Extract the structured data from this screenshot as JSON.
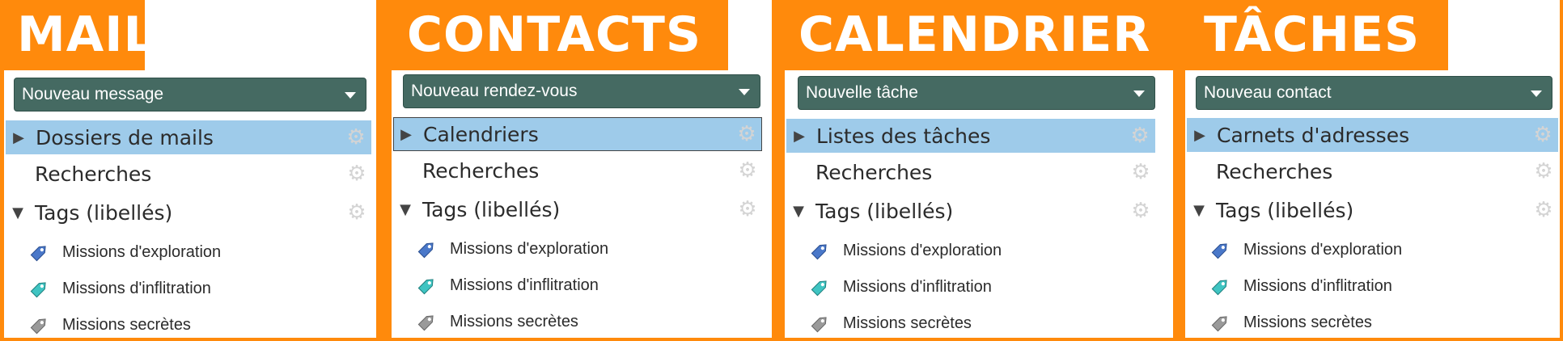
{
  "panels": [
    {
      "title": "MAIL",
      "dropdown": "Nouveau message",
      "folder": "Dossiers de mails",
      "searches": "Recherches",
      "tags_header": "Tags (libellés)",
      "tags": [
        "Missions d'exploration",
        "Missions d'inflitration",
        "Missions secrètes"
      ]
    },
    {
      "title": "CONTACTS",
      "dropdown": "Nouveau rendez-vous",
      "folder": "Calendriers",
      "searches": "Recherches",
      "tags_header": "Tags (libellés)",
      "tags": [
        "Missions d'exploration",
        "Missions d'inflitration",
        "Missions secrètes"
      ]
    },
    {
      "title": "CALENDRIER",
      "dropdown": "Nouvelle tâche",
      "folder": "Listes des tâches",
      "searches": "Recherches",
      "tags_header": "Tags (libellés)",
      "tags": [
        "Missions d'exploration",
        "Missions d'inflitration",
        "Missions secrètes"
      ]
    },
    {
      "title": "TÂCHES",
      "dropdown": "Nouveau contact",
      "folder": "Carnets d'adresses",
      "searches": "Recherches",
      "tags_header": "Tags (libellés)",
      "tags": [
        "Missions d'exploration",
        "Missions d'inflitration",
        "Missions secrètes"
      ]
    }
  ],
  "icons": {
    "collapsed": "triangle-right-icon",
    "expanded": "triangle-down-icon",
    "settings": "gear-icon",
    "tag": "tag-icon"
  },
  "colors": {
    "background": "#ff8a0c",
    "dropdown": "#456a62",
    "selected_row": "#9ecbea",
    "tag_blue": "#4a78c9",
    "tag_teal": "#3fc4c2",
    "tag_gray": "#9a9a9a"
  }
}
